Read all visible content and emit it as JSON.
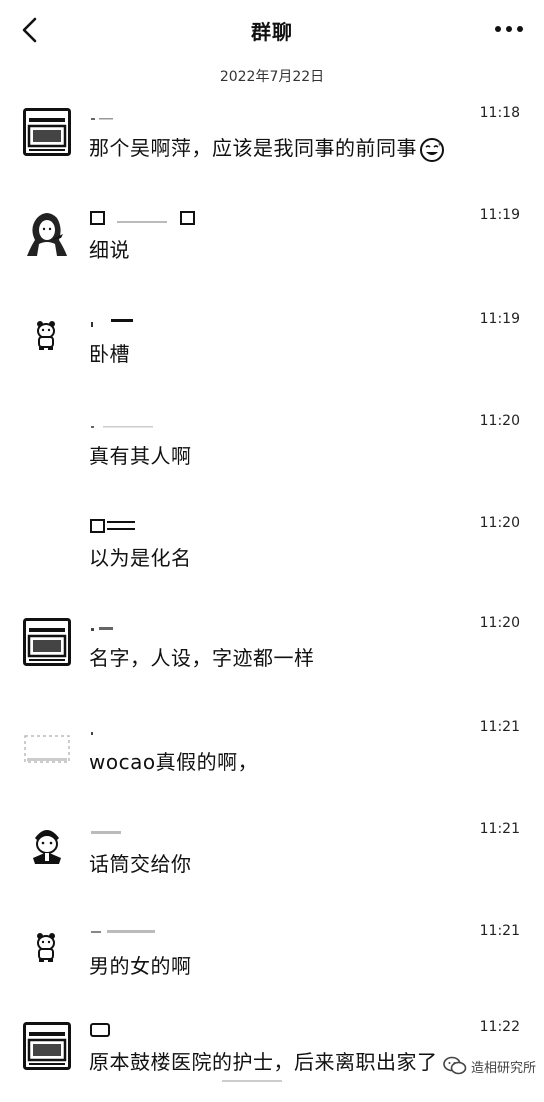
{
  "header": {
    "title": "群聊",
    "back_icon": "chevron-left-icon",
    "more_icon": "more-horizontal-icon"
  },
  "date": "2022年7月22日",
  "messages": [
    {
      "time": "11:18",
      "text": "那个吴啊萍，应该是我同事的前同事",
      "avatar": "book-avatar",
      "emoji": "sweat-smile-emoji"
    },
    {
      "time": "11:19",
      "text": "细说",
      "avatar": "girl-avatar"
    },
    {
      "time": "11:19",
      "text": "卧槽",
      "avatar": "bear-avatar"
    },
    {
      "time": "11:20",
      "text": "真有其人啊",
      "avatar": "blank-avatar"
    },
    {
      "time": "11:20",
      "text": "以为是化名",
      "avatar": "blank-avatar"
    },
    {
      "time": "11:20",
      "text": "名字，人设，字迹都一样",
      "avatar": "book-avatar"
    },
    {
      "time": "11:21",
      "text": "wocao真假的啊，",
      "avatar": "faded-avatar"
    },
    {
      "time": "11:21",
      "text": "话筒交给你",
      "avatar": "cartoon-avatar"
    },
    {
      "time": "11:21",
      "text": "男的女的啊",
      "avatar": "bear-avatar"
    },
    {
      "time": "11:22",
      "text": "原本鼓楼医院的护士，后来离职出家了",
      "avatar": "book-avatar"
    }
  ],
  "watermark": {
    "label": "造相研究所",
    "icon": "wechat-logo-icon"
  }
}
